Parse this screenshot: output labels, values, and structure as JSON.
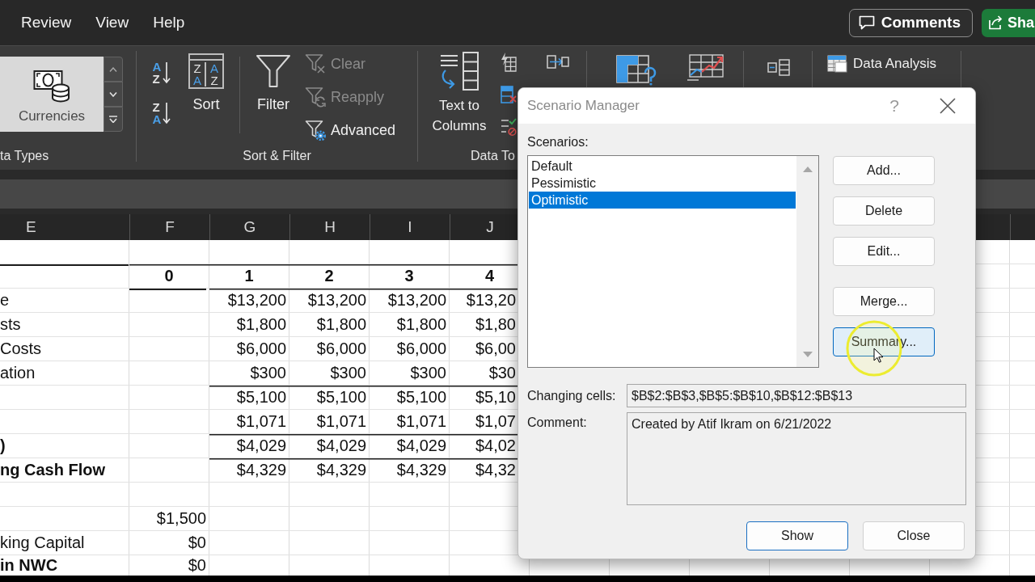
{
  "menu_tabs": [
    {
      "label": "Review"
    },
    {
      "label": "View"
    },
    {
      "label": "Help"
    }
  ],
  "header_buttons": [
    {
      "kind": "comments",
      "label": "Comments"
    },
    {
      "kind": "share",
      "label": "Sha"
    }
  ],
  "ribbon": {
    "groups": [
      {
        "kind": "data_types",
        "label": "ta Types",
        "gallery_item": "Currencies"
      },
      {
        "kind": "sort_filter",
        "label": "Sort & Filter",
        "sort_ascending": [
          "A",
          "Z"
        ],
        "sort_descending": [
          "Z",
          "A"
        ],
        "sort": {
          "label": "Sort",
          "letters": [
            "Z",
            "A",
            "A",
            "Z"
          ]
        },
        "filter": "Filter",
        "filter_commands": [
          {
            "kind": "clear",
            "label": "Clear",
            "disabled": true
          },
          {
            "kind": "reapply",
            "label": "Reapply",
            "disabled": true
          },
          {
            "kind": "advanced",
            "label": "Advanced",
            "disabled": false
          }
        ]
      },
      {
        "kind": "data_tools",
        "label": "Data To",
        "text_to_columns": "Text to Columns"
      },
      {
        "kind": "forecast"
      },
      {
        "kind": "outline"
      },
      {
        "kind": "analysis",
        "data_analysis": "Data Analysis"
      }
    ]
  },
  "sheet": {
    "columns": [
      "E",
      "F",
      "G",
      "H",
      "I",
      "J"
    ],
    "rows": [
      {
        "kind": "spacer"
      },
      {
        "kind": "periods",
        "cells": [
          null,
          "0",
          "1",
          "2",
          "3",
          "4"
        ],
        "rule_above": [
          true,
          true,
          true,
          true,
          true,
          true
        ]
      },
      {
        "kind": "values",
        "label_bold": false,
        "cells": [
          "e",
          null,
          "$13,200",
          "$13,200",
          "$13,200",
          "$13,20"
        ],
        "rule_above": [
          false,
          true,
          true,
          true,
          true,
          true
        ]
      },
      {
        "kind": "values",
        "label_bold": false,
        "cells": [
          "sts",
          null,
          "$1,800",
          "$1,800",
          "$1,800",
          "$1,80"
        ],
        "rule_above": [
          false,
          false,
          false,
          false,
          false,
          false
        ]
      },
      {
        "kind": "values",
        "label_bold": false,
        "cells": [
          "Costs",
          null,
          "$6,000",
          "$6,000",
          "$6,000",
          "$6,00"
        ],
        "rule_above": [
          false,
          false,
          false,
          false,
          false,
          false
        ]
      },
      {
        "kind": "values",
        "label_bold": false,
        "cells": [
          "ation",
          null,
          "$300",
          "$300",
          "$300",
          "$30"
        ],
        "rule_above": [
          false,
          false,
          false,
          false,
          false,
          false
        ]
      },
      {
        "kind": "values",
        "cells": [
          null,
          null,
          "$5,100",
          "$5,100",
          "$5,100",
          "$5,10"
        ],
        "rule_above": [
          false,
          false,
          true,
          true,
          true,
          true
        ]
      },
      {
        "kind": "values",
        "cells": [
          null,
          null,
          "$1,071",
          "$1,071",
          "$1,071",
          "$1,07"
        ],
        "rule_above": [
          false,
          false,
          false,
          false,
          false,
          false
        ]
      },
      {
        "kind": "values",
        "label_bold": true,
        "cells": [
          ")",
          null,
          "$4,029",
          "$4,029",
          "$4,029",
          "$4,02"
        ],
        "rule_above": [
          false,
          false,
          true,
          true,
          true,
          true
        ]
      },
      {
        "kind": "values",
        "label_bold": true,
        "cells": [
          "ng Cash Flow",
          null,
          "$4,329",
          "$4,329",
          "$4,329",
          "$4,32"
        ],
        "rule_above": [
          false,
          false,
          true,
          true,
          true,
          true
        ]
      },
      {
        "kind": "spacer"
      },
      {
        "kind": "values",
        "cells": [
          null,
          "$1,500",
          null,
          null,
          null,
          null
        ],
        "rule_above": [
          false,
          false,
          false,
          false,
          false,
          false
        ]
      },
      {
        "kind": "values",
        "label_bold": false,
        "cells": [
          "king Capital",
          "$0",
          null,
          null,
          null,
          null
        ],
        "rule_above": [
          false,
          false,
          false,
          false,
          false,
          false
        ]
      },
      {
        "kind": "values",
        "label_bold": true,
        "cells": [
          "in NWC",
          "$0",
          null,
          null,
          null,
          null
        ],
        "rule_above": [
          false,
          false,
          false,
          false,
          false,
          false
        ]
      }
    ]
  },
  "dialog": {
    "title": "Scenario Manager",
    "help": "?",
    "scenarios_label": "Scenarios:",
    "scenarios": [
      {
        "name": "Default",
        "selected": false
      },
      {
        "name": "Pessimistic",
        "selected": false
      },
      {
        "name": "Optimistic",
        "selected": true
      }
    ],
    "button_groups": [
      {
        "buttons": [
          {
            "label": "Add...",
            "hovered": false
          },
          {
            "label": "Delete",
            "hovered": false
          },
          {
            "label": "Edit...",
            "hovered": false
          }
        ]
      },
      {
        "buttons": [
          {
            "label": "Merge...",
            "hovered": false
          },
          {
            "label": "Summary...",
            "hovered": true
          }
        ]
      }
    ],
    "changing_cells": {
      "label": "Changing cells:",
      "value": "$B$2:$B$3,$B$5:$B$10,$B$12:$B$13"
    },
    "comment": {
      "label": "Comment:",
      "value": "Created by Atif Ikram on 6/21/2022"
    },
    "footer_buttons": [
      {
        "label": "Show",
        "default": true
      },
      {
        "label": "Close",
        "default": false
      }
    ]
  }
}
